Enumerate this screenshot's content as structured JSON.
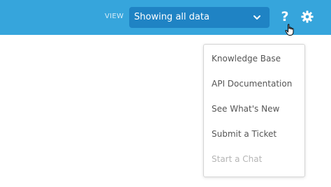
{
  "toolbar": {
    "view_label": "VIEW",
    "view_select_value": "Showing all data",
    "help_glyph": "?",
    "help_icon": "question-mark-icon",
    "settings_icon": "gear-icon",
    "background_color": "#36a5dc",
    "select_color": "#1f83c4"
  },
  "help_menu": {
    "items": [
      {
        "label": "Knowledge Base",
        "enabled": true
      },
      {
        "label": "API Documentation",
        "enabled": true
      },
      {
        "label": "See What's New",
        "enabled": true
      },
      {
        "label": "Submit a Ticket",
        "enabled": true
      },
      {
        "label": "Start a Chat",
        "enabled": false
      }
    ]
  }
}
